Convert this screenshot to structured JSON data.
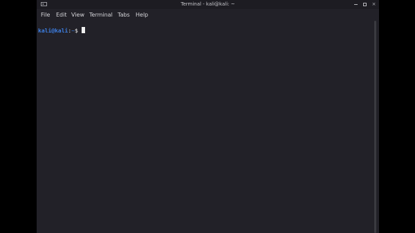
{
  "window": {
    "title": "Terminal - kali@kali: ~",
    "icon": "terminal-icon",
    "controls": [
      "minimize-icon",
      "maximize-icon",
      "close-icon"
    ],
    "close_glyph": "×"
  },
  "menu": {
    "file": "File",
    "edit": "Edit",
    "view": "View",
    "terminal": "Terminal",
    "tabs": "Tabs",
    "help": "Help"
  },
  "terminal": {
    "user_host": "kali@kali",
    "separator": ":",
    "path": "~",
    "prompt_symbol": "$",
    "input": ""
  },
  "colors": {
    "background": "#222128",
    "prompt": "#3d7fe4",
    "text": "#e6e6e6"
  }
}
